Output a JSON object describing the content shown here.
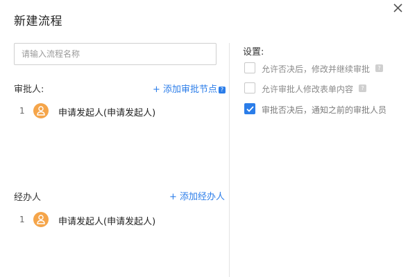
{
  "dialog": {
    "title": "新建流程",
    "name_input": {
      "placeholder": "请输入流程名称",
      "value": ""
    }
  },
  "approvers": {
    "label": "审批人:",
    "add_link": "+ 添加审批节点",
    "help_icon": "question-icon",
    "items": [
      {
        "index": "1",
        "name": "申请发起人(申请发起人)",
        "avatar_icon": "user-icon"
      }
    ]
  },
  "handlers": {
    "label": "经办人",
    "add_link": "+ 添加经办人",
    "items": [
      {
        "index": "1",
        "name": "申请发起人(申请发起人)",
        "avatar_icon": "user-icon"
      }
    ]
  },
  "settings": {
    "label": "设置:",
    "options": [
      {
        "label": "允许否决后，修改并继续审批",
        "checked": false,
        "help": true
      },
      {
        "label": "允许审批人修改表单内容",
        "checked": false,
        "help": true
      },
      {
        "label": "审批否决后，通知之前的审批人员",
        "checked": true,
        "help": false
      }
    ]
  },
  "colors": {
    "accent": "#2b7de9",
    "avatar": "#f5a54a",
    "border": "#cfcfcf"
  }
}
